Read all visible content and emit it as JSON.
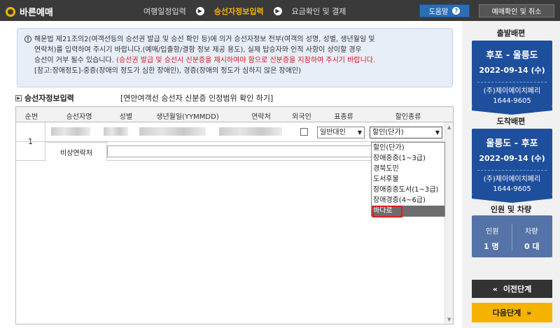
{
  "header": {
    "logo": "바른예매",
    "steps": [
      "여행일정입력",
      "승선자정보입력",
      "요금확인 및 결제"
    ],
    "active_step": 1,
    "help_label": "도움말",
    "resv_label": "예매확인 및 취소"
  },
  "notice": {
    "line1": "해운법 제21조의2(여객선등의 승선권 발급 및 승선 확인 등)에 의거 승선자정보 전부(여객의 성명, 성별, 생년월일 및",
    "line2": "연락처)를 입력하여 주시기 바랍니다.(예매/입출항/결항 정보 제공 용도), 실제 탑승자와 인적 사항이 상이할 경우",
    "line3a": "승선이 거부 될수 있습니다. ",
    "line3b": "(승선권 발급 및 승선시 신분증을 제시하여야 함으로 신분증을 지참하여 주시기 바랍니다.",
    "line4": "[참고:장애정도]-중증(장애의 정도가 심한 장애인), 경증(장애의 정도가 심하지 않은 장애인)"
  },
  "section": {
    "title": "승선자정보입력",
    "link": "[연안여객선 승선자 신분증 인정범위 확인 하기]"
  },
  "table": {
    "headers": [
      "순번",
      "승선자명",
      "성별",
      "생년월일(YYMMDD)",
      "연락처",
      "외국인",
      "표종류",
      "할인종류"
    ],
    "row": {
      "no": "1",
      "ticket_type": "일반대인",
      "discount_type": "할인(단가)",
      "emergency_label": "비상연락처"
    }
  },
  "dropdown": {
    "options": [
      "할인(단가)",
      "장애중증(1~3급)",
      "경북도민",
      "도서후불",
      "장애중증도서(1~3급)",
      "장애경증(4~6급)",
      "바다로"
    ],
    "highlighted": 6
  },
  "sidebar": {
    "departure_head": "출발배편",
    "departure": {
      "route": "후포 - 울릉도",
      "date": "2022-09-14 (수)",
      "carrier": "(주)제이에이치페리",
      "phone": "1644-9605"
    },
    "arrival_head": "도착배편",
    "arrival": {
      "route": "울릉도 - 후포",
      "date": "2022-09-14 (수)",
      "carrier": "(주)제이에이치페리",
      "phone": "1644-9605"
    },
    "count_head": "인원 및 차량",
    "persons_label": "인원",
    "persons_value": "1 명",
    "vehicles_label": "차량",
    "vehicles_value": "0 대",
    "prev_label": "이전단계",
    "next_label": "다음단계"
  },
  "colors": {
    "accent": "#f5b300",
    "card": "#1e4f9c",
    "highlight_border": "#e11b1b"
  }
}
